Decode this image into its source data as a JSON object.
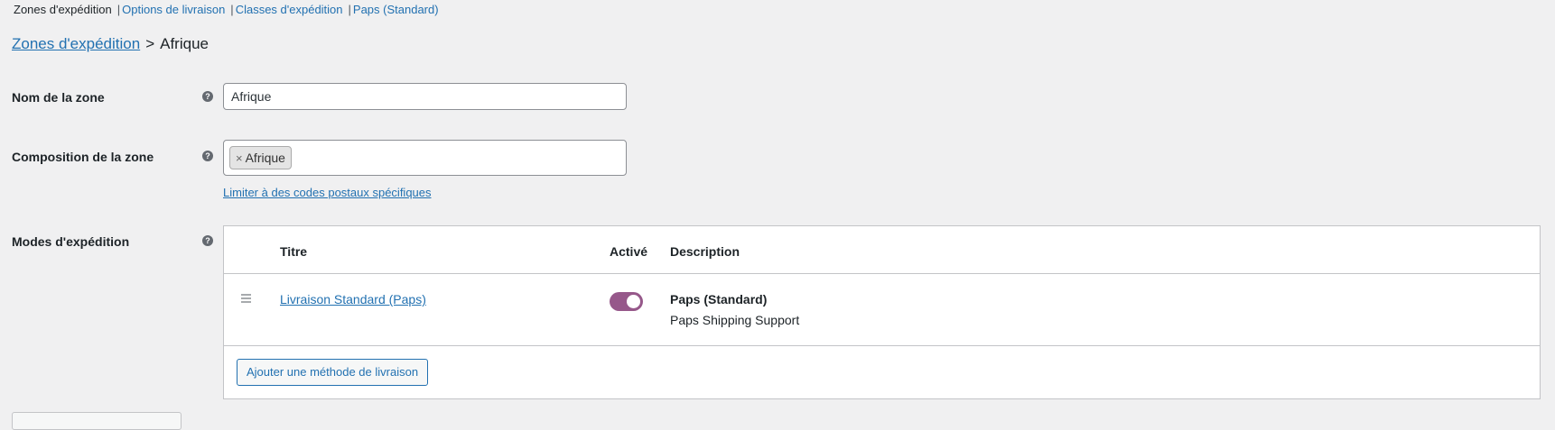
{
  "subnav": {
    "current": "Zones d'expédition",
    "links": [
      "Options de livraison",
      "Classes d'expédition",
      "Paps (Standard)"
    ],
    "separator": "|"
  },
  "breadcrumb": {
    "parent": "Zones d'expédition",
    "separator": ">",
    "current": "Afrique"
  },
  "zone_name": {
    "label": "Nom de la zone",
    "value": "Afrique"
  },
  "zone_regions": {
    "label": "Composition de la zone",
    "tokens": [
      {
        "remove": "×",
        "label": "Afrique"
      }
    ],
    "postcode_link": "Limiter à des codes postaux spécifiques"
  },
  "help_glyph": "?",
  "shipping_methods": {
    "label": "Modes d'expédition",
    "headers": {
      "title": "Titre",
      "enabled": "Activé",
      "description": "Description"
    },
    "rows": [
      {
        "title": "Livraison Standard (Paps)",
        "enabled": true,
        "description_title": "Paps (Standard)",
        "description_text": "Paps Shipping Support"
      }
    ],
    "add_button": "Ajouter une méthode de livraison"
  },
  "colors": {
    "link": "#2271b1",
    "toggle_on": "#96588a",
    "background": "#f0f0f1"
  }
}
